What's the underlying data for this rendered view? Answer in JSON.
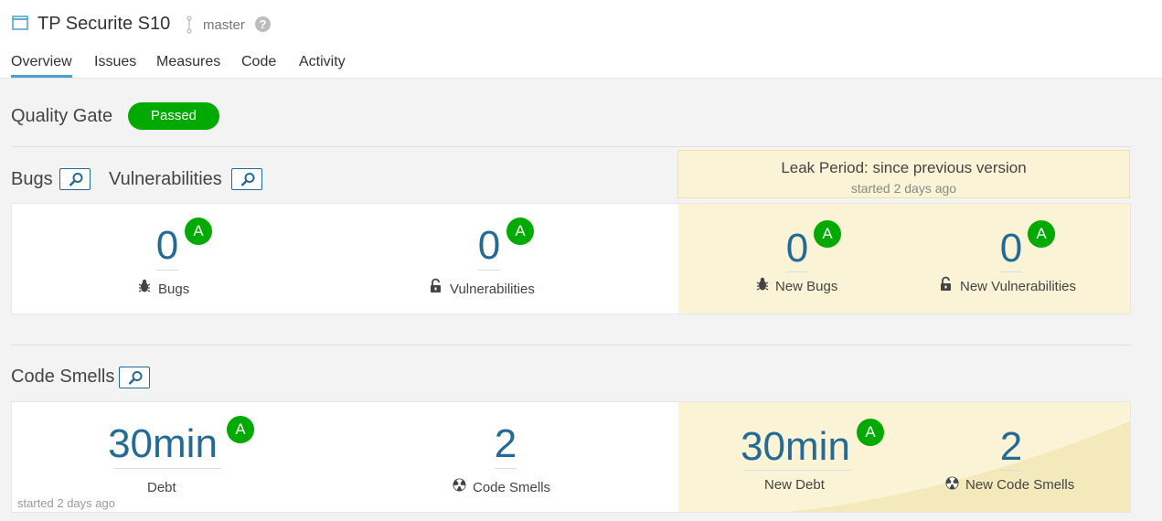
{
  "header": {
    "project_title": "TP Securite S10",
    "branch": "master",
    "help_glyph": "?"
  },
  "tabs": [
    {
      "label": "Overview",
      "active": true
    },
    {
      "label": "Issues",
      "active": false
    },
    {
      "label": "Measures",
      "active": false
    },
    {
      "label": "Code",
      "active": false
    },
    {
      "label": "Activity",
      "active": false
    }
  ],
  "quality_gate": {
    "label": "Quality Gate",
    "status": "Passed",
    "status_color": "#00aa00"
  },
  "leak_period": {
    "title": "Leak Period: since previous version",
    "started": "started 2 days ago"
  },
  "bugs_section": {
    "bugs_title": "Bugs",
    "vulnerabilities_title": "Vulnerabilities",
    "bugs": {
      "value": "0",
      "rating": "A",
      "label": "Bugs",
      "icon": "bug-icon"
    },
    "vulnerabilities": {
      "value": "0",
      "rating": "A",
      "label": "Vulnerabilities",
      "icon": "lock-icon"
    },
    "new_bugs": {
      "value": "0",
      "rating": "A",
      "label": "New Bugs",
      "icon": "bug-icon"
    },
    "new_vulnerabilities": {
      "value": "0",
      "rating": "A",
      "label": "New Vulnerabilities",
      "icon": "lock-icon"
    }
  },
  "code_smells_section": {
    "title": "Code Smells",
    "debt": {
      "value": "30min",
      "rating": "A",
      "label": "Debt"
    },
    "code_smells": {
      "value": "2",
      "label": "Code Smells",
      "icon": "code-smell-icon"
    },
    "new_debt": {
      "value": "30min",
      "rating": "A",
      "label": "New Debt"
    },
    "new_code_smells": {
      "value": "2",
      "label": "New Code Smells",
      "icon": "code-smell-icon"
    },
    "started": "started 2 days ago"
  },
  "colors": {
    "accent": "#236a97",
    "rating_a": "#00aa00",
    "leak_background": "#fbf3d5"
  }
}
